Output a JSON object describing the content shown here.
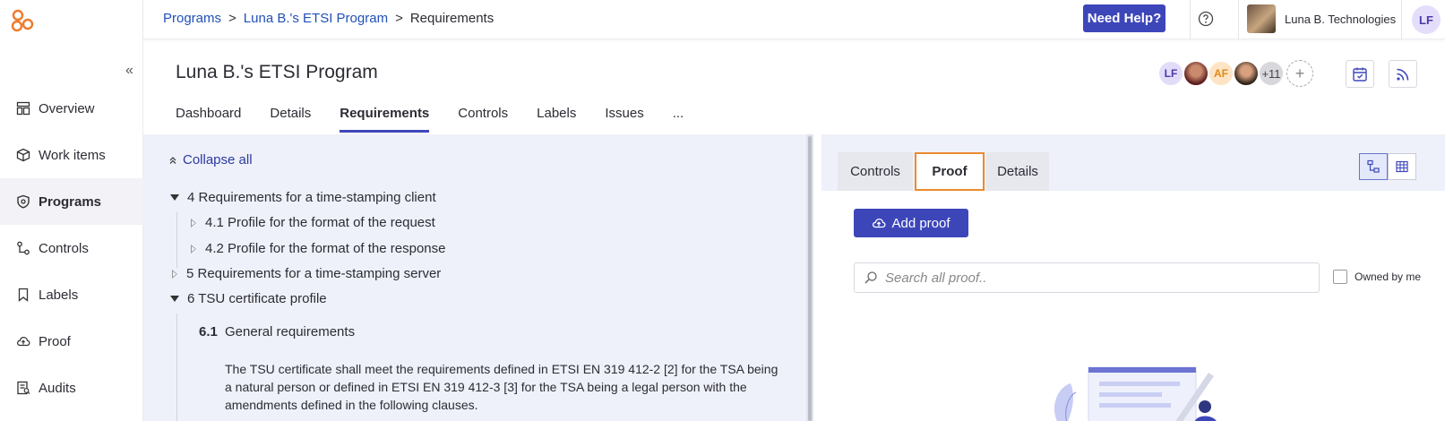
{
  "sidebar": {
    "logo_icon": "brand-logo-icon",
    "collapse_glyph": "«",
    "items": [
      {
        "label": "Overview",
        "icon": "dashboard-icon",
        "active": false
      },
      {
        "label": "Work items",
        "icon": "box-icon",
        "active": false
      },
      {
        "label": "Programs",
        "icon": "shield-icon",
        "active": true
      },
      {
        "label": "Controls",
        "icon": "controls-icon",
        "active": false
      },
      {
        "label": "Labels",
        "icon": "bookmark-icon",
        "active": false
      },
      {
        "label": "Proof",
        "icon": "cloud-upload-icon",
        "active": false
      },
      {
        "label": "Audits",
        "icon": "audit-icon",
        "active": false
      }
    ]
  },
  "topbar": {
    "breadcrumb": [
      "Programs",
      "Luna B.'s ETSI Program",
      "Requirements"
    ],
    "breadcrumb_sep": ">",
    "help_label": "Need Help?",
    "org_name": "Luna B. Technologies",
    "user_initials": "LF"
  },
  "header": {
    "title": "Luna B.'s ETSI Program",
    "avatars": [
      {
        "initials": "LF",
        "kind": "lf"
      },
      {
        "initials": "",
        "kind": "p1"
      },
      {
        "initials": "AF",
        "kind": "af"
      },
      {
        "initials": "",
        "kind": "p2"
      },
      {
        "initials": "+11",
        "kind": "more"
      }
    ],
    "add_glyph": "+",
    "tabs": [
      {
        "label": "Dashboard",
        "active": false
      },
      {
        "label": "Details",
        "active": false
      },
      {
        "label": "Requirements",
        "active": true
      },
      {
        "label": "Controls",
        "active": false
      },
      {
        "label": "Labels",
        "active": false
      },
      {
        "label": "Issues",
        "active": false
      },
      {
        "label": "...",
        "active": false
      }
    ]
  },
  "requirements": {
    "collapse_all": "Collapse all",
    "tree": [
      {
        "label": "4 Requirements for a time-stamping client",
        "expanded": true,
        "level": 0
      },
      {
        "label": "4.1 Profile for the format of the request",
        "expanded": false,
        "level": 1
      },
      {
        "label": "4.2 Profile for the format of the response",
        "expanded": false,
        "level": 1
      },
      {
        "label": "5 Requirements for a time-stamping server",
        "expanded": false,
        "level": 0
      },
      {
        "label": "6 TSU certificate profile",
        "expanded": true,
        "level": 0
      }
    ],
    "section": {
      "number": "6.1",
      "title": "General requirements",
      "body": "The TSU certificate shall meet the requirements defined in ETSI EN 319 412-2 [2] for the TSA being a natural person or defined in ETSI EN 319 412-3 [3] for the TSA being a legal person with the amendments defined in the following clauses."
    }
  },
  "proof_panel": {
    "tabs": [
      {
        "label": "Controls",
        "active": false
      },
      {
        "label": "Proof",
        "active": true
      },
      {
        "label": "Details",
        "active": false
      }
    ],
    "add_proof_label": "Add proof",
    "search_placeholder": "Search all proof..",
    "owned_by_me": "Owned by me",
    "highlight_color": "#ec8a2e"
  },
  "colors": {
    "primary": "#3d46b9",
    "link": "#2150b8",
    "pane_bg": "#eef1f9",
    "brand_logo": "#f07a2a"
  }
}
